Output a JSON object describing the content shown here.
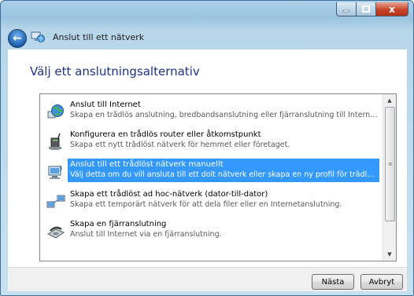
{
  "window": {
    "title": "Anslut till ett nätverk",
    "caption_close": "x"
  },
  "heading": "Välj ett anslutningsalternativ",
  "options": [
    {
      "label": "Anslut till Internet",
      "description": "Skapa en trådlös anslutning, bredbandsanslutning eller fjärranslutning till Internet.",
      "icon": "globe-network-icon",
      "selected": false
    },
    {
      "label": "Konfigurera en trådlös router eller åtkomstpunkt",
      "description": "Skapa ett nytt trådlöst nätverk för hemmet eller företaget.",
      "icon": "wireless-router-icon",
      "selected": false
    },
    {
      "label": "Anslut till ett trådlöst nätverk manuellt",
      "description": "Välj detta om du vill ansluta till ett dolt nätverk eller skapa en ny profil för trådlöst nätve...",
      "icon": "wireless-computer-icon",
      "selected": true
    },
    {
      "label": "Skapa ett trådlöst ad hoc-nätverk (dator-till-dator)",
      "description": "Skapa ett temporärt nätverk för att dela filer eller en Internetanslutning.",
      "icon": "adhoc-network-icon",
      "selected": false
    },
    {
      "label": "Skapa en fjärranslutning",
      "description": "Anslut till Internet via en fjärranslutning.",
      "icon": "dialup-modem-icon",
      "selected": false
    }
  ],
  "buttons": {
    "next": "Nästa",
    "cancel": "Avbryt"
  },
  "colors": {
    "heading": "#1e3287",
    "selection": "#3399ff"
  }
}
